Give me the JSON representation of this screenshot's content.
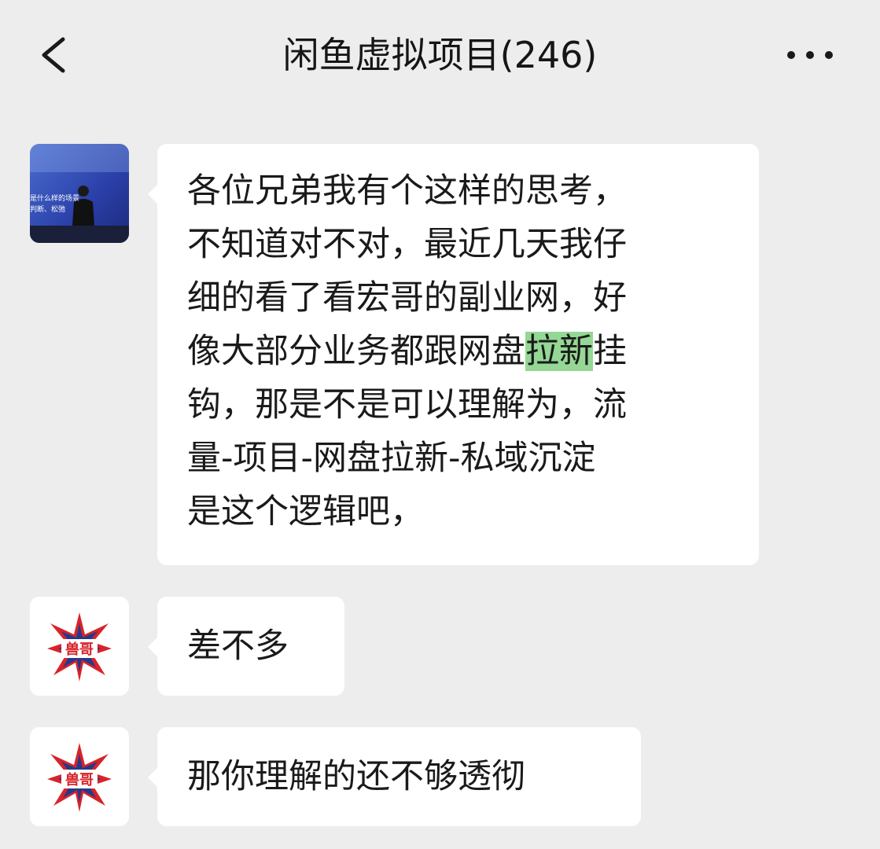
{
  "header": {
    "title": "闲鱼虚拟项目(246)",
    "back_icon": "chevron-left-icon",
    "more_icon": "more-horizontal-icon"
  },
  "messages": [
    {
      "avatar": {
        "type": "photo",
        "caption_line1": "是什么样的场景",
        "caption_line2": "判断、松弛"
      },
      "lines": [
        {
          "text": "各位兄弟我有个这样的思考，"
        },
        {
          "text": "不知道对不对，最近几天我仔"
        },
        {
          "text": "细的看了看宏哥的副业网，好"
        },
        {
          "before": "像大部分业务都跟网盘",
          "highlight": "拉新",
          "after": "挂"
        },
        {
          "text": "钩，那是不是可以理解为，流"
        },
        {
          "text": "量-项目-网盘拉新-私域沉淀"
        },
        {
          "text": "是这个逻辑吧，"
        }
      ]
    },
    {
      "avatar": {
        "type": "logo",
        "logo_text": "兽哥"
      },
      "text": "差不多"
    },
    {
      "avatar": {
        "type": "logo",
        "logo_text": "兽哥"
      },
      "text": "那你理解的还不够透彻"
    }
  ],
  "colors": {
    "background": "#ededed",
    "bubble": "#ffffff",
    "highlight": "#95d795",
    "text": "#1a1a1a",
    "logo_red": "#d8232a",
    "logo_blue": "#233a8b"
  }
}
